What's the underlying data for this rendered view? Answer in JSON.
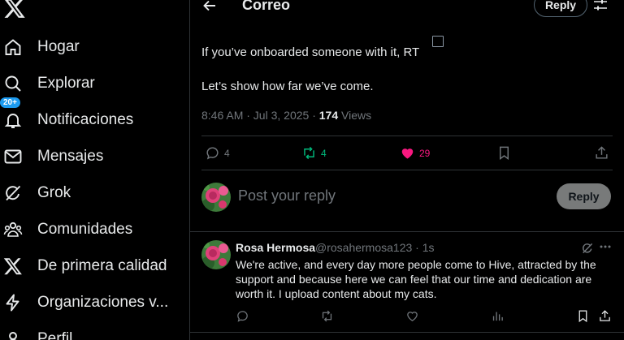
{
  "nav": {
    "items": [
      {
        "label": "Hogar",
        "icon": "home-icon"
      },
      {
        "label": "Explorar",
        "icon": "search-icon"
      },
      {
        "label": "Notificaciones",
        "icon": "bell-icon",
        "badge": "20+"
      },
      {
        "label": "Mensajes",
        "icon": "mail-icon"
      },
      {
        "label": "Grok",
        "icon": "grok-icon"
      },
      {
        "label": "Comunidades",
        "icon": "communities-icon"
      },
      {
        "label": "De primera calidad",
        "icon": "x-premium-icon"
      },
      {
        "label": "Organizaciones v...",
        "icon": "lightning-icon"
      },
      {
        "label": "Perfil",
        "icon": "profile-icon"
      }
    ]
  },
  "header": {
    "title": "Correo",
    "reply_label": "Reply"
  },
  "tweet": {
    "line1": "If you’ve onboarded someone with it, RT",
    "line2": "Let’s show how far we’ve come.",
    "timestamp": "8:46 AM · Jul 3, 2025 · ",
    "views_count": "174",
    "views_label": " Views",
    "replies": "4",
    "retweets": "4",
    "likes": "29"
  },
  "compose": {
    "placeholder": "Post your reply",
    "button": "Reply"
  },
  "reply": {
    "name": "Rosa Hermosa",
    "handle": "@rosahermosa123 · 1s",
    "text": "We're active, and every day more people come to Hive, attracted by the support and because here we can feel that our time and dedication are worth it. I upload content about my cats."
  },
  "colors": {
    "accent": "#1d9bf0",
    "retweet": "#00ba7c",
    "like": "#f91880",
    "muted": "#71767b"
  }
}
